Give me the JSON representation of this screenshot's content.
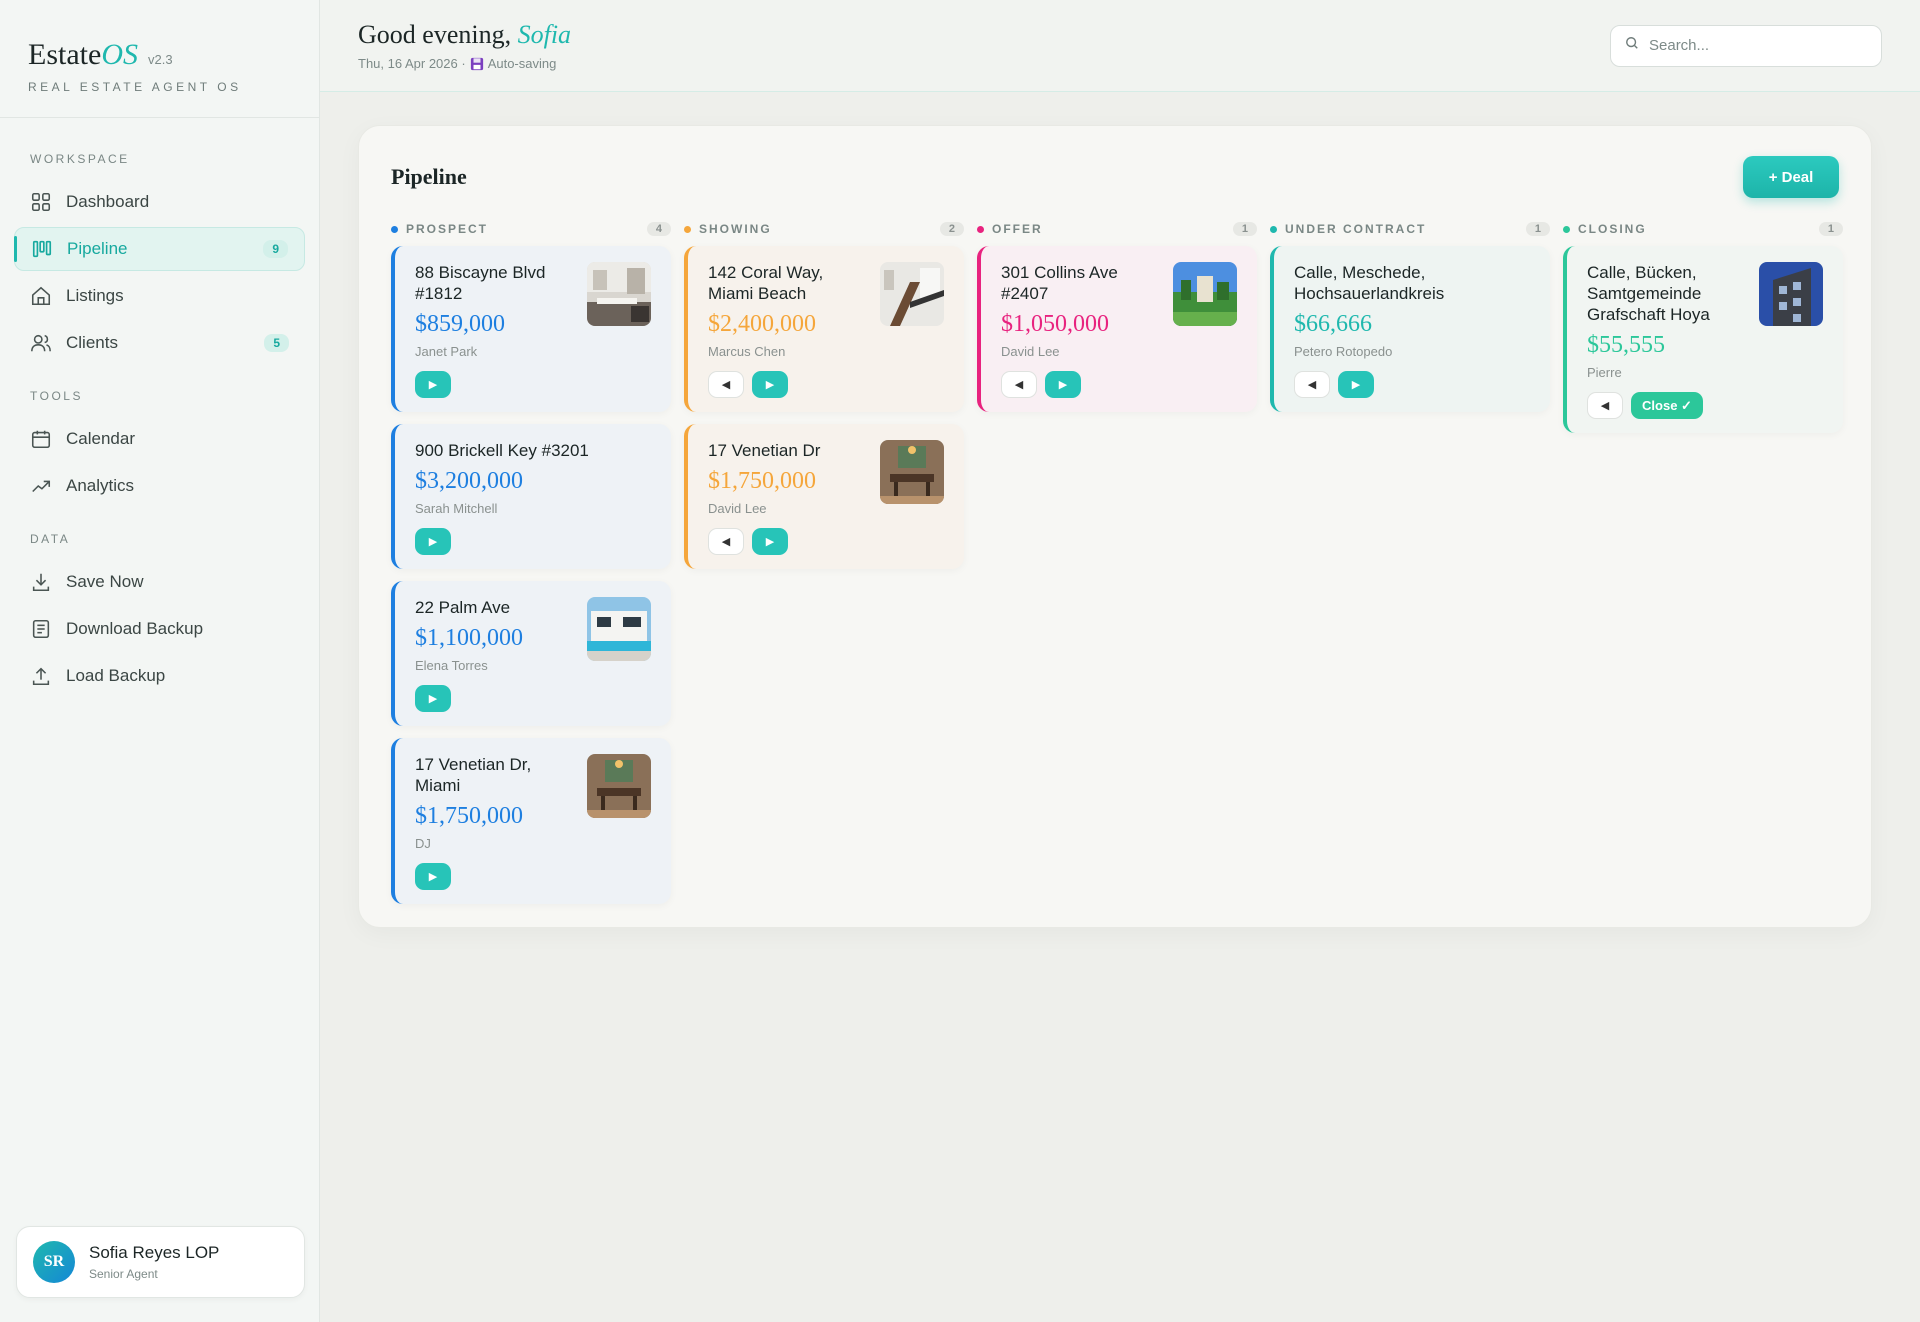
{
  "brand": {
    "name": "Estate",
    "os": "OS",
    "version": "v2.3",
    "subtitle": "REAL ESTATE AGENT OS"
  },
  "sidebar": {
    "sections": {
      "workspace": "WORKSPACE",
      "tools": "TOOLS",
      "data": "DATA"
    },
    "items": [
      {
        "label": "Dashboard",
        "icon": "grid-icon"
      },
      {
        "label": "Pipeline",
        "icon": "kanban-icon",
        "badge": "9",
        "active": true
      },
      {
        "label": "Listings",
        "icon": "home-icon"
      },
      {
        "label": "Clients",
        "icon": "users-icon",
        "badge": "5"
      },
      {
        "label": "Calendar",
        "icon": "calendar-icon"
      },
      {
        "label": "Analytics",
        "icon": "trend-icon"
      },
      {
        "label": "Save Now",
        "icon": "download-icon"
      },
      {
        "label": "Download Backup",
        "icon": "document-icon"
      },
      {
        "label": "Load Backup",
        "icon": "upload-icon"
      }
    ]
  },
  "user": {
    "initials": "SR",
    "name": "Sofia Reyes LOP",
    "role": "Senior Agent"
  },
  "header": {
    "greeting": "Good evening,",
    "name": "Sofia",
    "date": "Thu, 16 Apr 2026 ·",
    "status": "Auto-saving"
  },
  "search": {
    "placeholder": "Search..."
  },
  "pipeline": {
    "title": "Pipeline",
    "add_label": "+ Deal",
    "columns": [
      {
        "title": "PROSPECT",
        "count": "4",
        "color": "#1e7fe0"
      },
      {
        "title": "SHOWING",
        "count": "2",
        "color": "#f5a63b"
      },
      {
        "title": "OFFER",
        "count": "1",
        "color": "#e8237f"
      },
      {
        "title": "UNDER CONTRACT",
        "count": "1",
        "color": "#1fb8ae"
      },
      {
        "title": "CLOSING",
        "count": "1",
        "color": "#2cc79a"
      }
    ],
    "deals": {
      "prospect": [
        {
          "address": "88 Biscayne Blvd #1812",
          "price": "$859,000",
          "client": "Janet Park"
        },
        {
          "address": "900 Brickell Key #3201",
          "price": "$3,200,000",
          "client": "Sarah Mitchell"
        },
        {
          "address": "22 Palm Ave",
          "price": "$1,100,000",
          "client": "Elena Torres"
        },
        {
          "address": "17 Venetian Dr, Miami",
          "price": "$1,750,000",
          "client": "DJ"
        }
      ],
      "showing": [
        {
          "address": "142 Coral Way, Miami Beach",
          "price": "$2,400,000",
          "client": "Marcus Chen"
        },
        {
          "address": "17 Venetian Dr",
          "price": "$1,750,000",
          "client": "David Lee"
        }
      ],
      "offer": [
        {
          "address": "301 Collins Ave #2407",
          "price": "$1,050,000",
          "client": "David Lee"
        }
      ],
      "contract": [
        {
          "address": "Calle, Meschede, Hochsauerlandkreis",
          "price": "$66,666",
          "client": "Petero Rotopedo"
        }
      ],
      "closing": [
        {
          "address": "Calle, Bücken, Samtgemeinde Grafschaft Hoya",
          "price": "$55,555",
          "client": "Pierre",
          "close_label": "Close ✓"
        }
      ]
    },
    "back_glyph": "◀",
    "forward_glyph": "▶"
  }
}
